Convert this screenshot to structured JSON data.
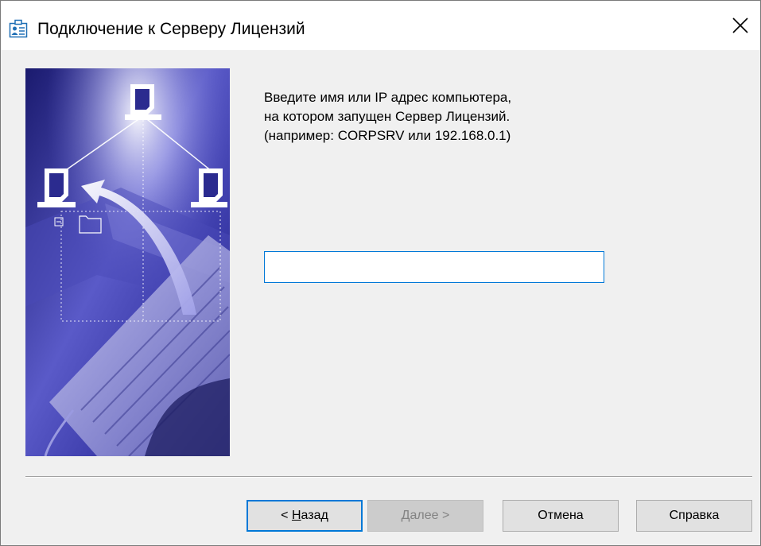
{
  "window": {
    "title": "Подключение к Серверу Лицензий",
    "icon": "license-server-icon",
    "close_icon": "close-icon"
  },
  "instructions": {
    "line1": "Введите имя или IP адрес компьютера,",
    "line2": "на котором запущен Сервер Лицензий.",
    "line3": "(например: CORPSRV или 192.168.0.1)"
  },
  "server_input": {
    "value": "",
    "placeholder": ""
  },
  "buttons": {
    "back_prefix": "< ",
    "back_accel": "Н",
    "back_rest": "азад",
    "next_accel": "Д",
    "next_rest": "алее >",
    "cancel": "Отмена",
    "help": "Справка"
  },
  "colors": {
    "focus_accent": "#0078d7",
    "dialog_bg": "#f0f0f0",
    "art_primary": "#2b2b8f"
  }
}
